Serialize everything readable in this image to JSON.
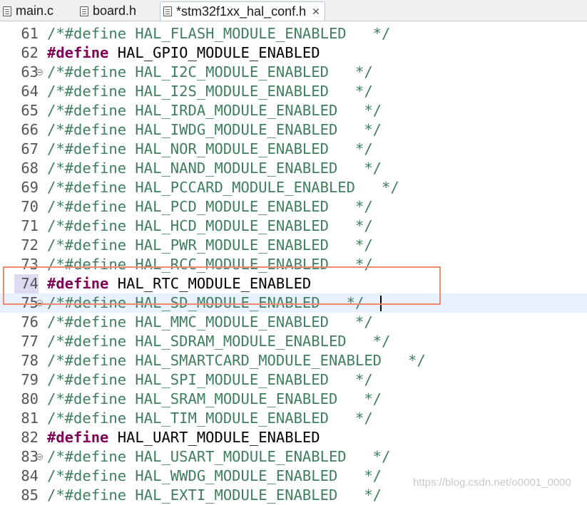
{
  "tabs": [
    {
      "label": "main.c",
      "icon": "c-file-icon",
      "active": false
    },
    {
      "label": "board.h",
      "icon": "h-file-icon",
      "active": false
    },
    {
      "label": "*stm32f1xx_hal_conf.h",
      "icon": "h-file-icon",
      "active": true,
      "close": "✕"
    }
  ],
  "lines": [
    {
      "num": "61",
      "kind": "comment",
      "text": "/*#define HAL_FLASH_MODULE_ENABLED   */"
    },
    {
      "num": "62",
      "kind": "define",
      "keyword": "#define",
      "rest": " HAL_GPIO_MODULE_ENABLED"
    },
    {
      "num": "63",
      "kind": "comment",
      "fold": true,
      "text": "/*#define HAL_I2C_MODULE_ENABLED   */"
    },
    {
      "num": "64",
      "kind": "comment",
      "text": "/*#define HAL_I2S_MODULE_ENABLED   */"
    },
    {
      "num": "65",
      "kind": "comment",
      "text": "/*#define HAL_IRDA_MODULE_ENABLED   */"
    },
    {
      "num": "66",
      "kind": "comment",
      "text": "/*#define HAL_IWDG_MODULE_ENABLED   */"
    },
    {
      "num": "67",
      "kind": "comment",
      "text": "/*#define HAL_NOR_MODULE_ENABLED   */"
    },
    {
      "num": "68",
      "kind": "comment",
      "text": "/*#define HAL_NAND_MODULE_ENABLED   */"
    },
    {
      "num": "69",
      "kind": "comment",
      "text": "/*#define HAL_PCCARD_MODULE_ENABLED   */"
    },
    {
      "num": "70",
      "kind": "comment",
      "text": "/*#define HAL_PCD_MODULE_ENABLED   */"
    },
    {
      "num": "71",
      "kind": "comment",
      "text": "/*#define HAL_HCD_MODULE_ENABLED   */"
    },
    {
      "num": "72",
      "kind": "comment",
      "text": "/*#define HAL_PWR_MODULE_ENABLED   */"
    },
    {
      "num": "73",
      "kind": "comment",
      "text": "/*#define HAL_RCC_MODULE_ENABLED   */"
    },
    {
      "num": "74",
      "kind": "define",
      "highlight": true,
      "keyword": "#define",
      "rest": " HAL_RTC_MODULE_ENABLED"
    },
    {
      "num": "75",
      "kind": "comment",
      "fold": true,
      "current": true,
      "caret": true,
      "text": "/*#define HAL_SD_MODULE_ENABLED   */"
    },
    {
      "num": "76",
      "kind": "comment",
      "text": "/*#define HAL_MMC_MODULE_ENABLED   */"
    },
    {
      "num": "77",
      "kind": "comment",
      "text": "/*#define HAL_SDRAM_MODULE_ENABLED   */"
    },
    {
      "num": "78",
      "kind": "comment",
      "text": "/*#define HAL_SMARTCARD_MODULE_ENABLED   */"
    },
    {
      "num": "79",
      "kind": "comment",
      "text": "/*#define HAL_SPI_MODULE_ENABLED   */"
    },
    {
      "num": "80",
      "kind": "comment",
      "text": "/*#define HAL_SRAM_MODULE_ENABLED   */"
    },
    {
      "num": "81",
      "kind": "comment",
      "text": "/*#define HAL_TIM_MODULE_ENABLED   */"
    },
    {
      "num": "82",
      "kind": "define",
      "keyword": "#define",
      "rest": " HAL_UART_MODULE_ENABLED"
    },
    {
      "num": "83",
      "kind": "comment",
      "fold": true,
      "text": "/*#define HAL_USART_MODULE_ENABLED   */"
    },
    {
      "num": "84",
      "kind": "comment",
      "text": "/*#define HAL_WWDG_MODULE_ENABLED   */"
    },
    {
      "num": "85",
      "kind": "comment",
      "text": "/*#define HAL_EXTI_MODULE_ENABLED   */"
    }
  ],
  "colors": {
    "comment": "#3f7f5f",
    "directive": "#7f0055",
    "current_line": "#e8f2fe",
    "annotation_box": "#ef8a6e"
  },
  "watermark": "https://blog.csdn.net/o0001_0000"
}
